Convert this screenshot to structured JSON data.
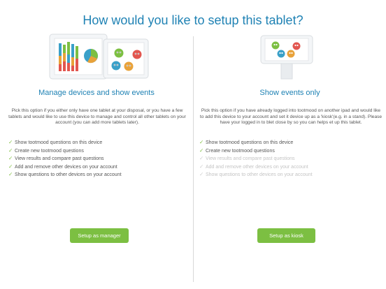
{
  "page": {
    "title": "How would you like to setup this tablet?"
  },
  "left": {
    "heading": "Manage devices and show events",
    "description": "Pick this option if you either only have one tablet at your disposal, or you have a few tablets and would like to use this device to manage and control all other tablets on your account (you can add more tablets later).",
    "features": [
      {
        "label": "Show tootmood questions on this device",
        "enabled": true
      },
      {
        "label": "Create new tootmood questions",
        "enabled": true
      },
      {
        "label": "View results and compare past questions",
        "enabled": true
      },
      {
        "label": "Add and remove other devices on your account",
        "enabled": true
      },
      {
        "label": "Show questions to other devices on your account",
        "enabled": true
      }
    ],
    "button": "Setup as manager"
  },
  "right": {
    "heading": "Show events only",
    "description": "Pick this option if you have already logged into tootmood on another ipad and would like to add this device to your account and set it device up as a 'kiosk'(e.g. in a stand). Please have your logged in to blet close by so you can helps et up this tablet.",
    "features": [
      {
        "label": "Show tootmood questions on this device",
        "enabled": true
      },
      {
        "label": "Create new tootmood questions",
        "enabled": true
      },
      {
        "label": "View results and compare past questions",
        "enabled": false
      },
      {
        "label": "Add and remove other devices on your account",
        "enabled": false
      },
      {
        "label": "Show questions to other devices on your account",
        "enabled": false
      }
    ],
    "button": "Setup as kiosk"
  },
  "icons": {
    "check": "check-icon"
  },
  "colors": {
    "title": "#1f82b4",
    "button": "#7cbf42",
    "check": "#7fbf3f",
    "disabled": "#c4c4c4"
  }
}
